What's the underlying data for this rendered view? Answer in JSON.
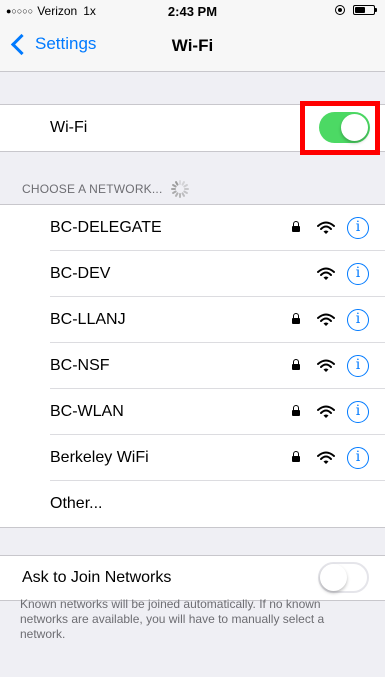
{
  "status_bar": {
    "signal_dots": "●○○○○",
    "carrier": "Verizon",
    "mode": "1x",
    "time": "2:43 PM",
    "battery_fraction": 0.55
  },
  "nav": {
    "back_label": "Settings",
    "title": "Wi-Fi"
  },
  "wifi_toggle": {
    "label": "Wi-Fi",
    "on": true
  },
  "networks_section": {
    "header": "CHOOSE A NETWORK...",
    "networks": [
      {
        "name": "BC-DELEGATE",
        "secured": true
      },
      {
        "name": "BC-DEV",
        "secured": false
      },
      {
        "name": "BC-LLANJ",
        "secured": true
      },
      {
        "name": "BC-NSF",
        "secured": true
      },
      {
        "name": "BC-WLAN",
        "secured": true
      },
      {
        "name": "Berkeley WiFi",
        "secured": true
      }
    ],
    "other_label": "Other...",
    "info_glyph": "i"
  },
  "ask_to_join": {
    "label": "Ask to Join Networks",
    "on": false,
    "note": "Known networks will be joined automatically. If no known networks are available, you will have to manually select a network."
  },
  "colors": {
    "accent": "#007aff",
    "toggle_on": "#4cd964",
    "highlight": "#ff0000",
    "background": "#efeff4"
  }
}
